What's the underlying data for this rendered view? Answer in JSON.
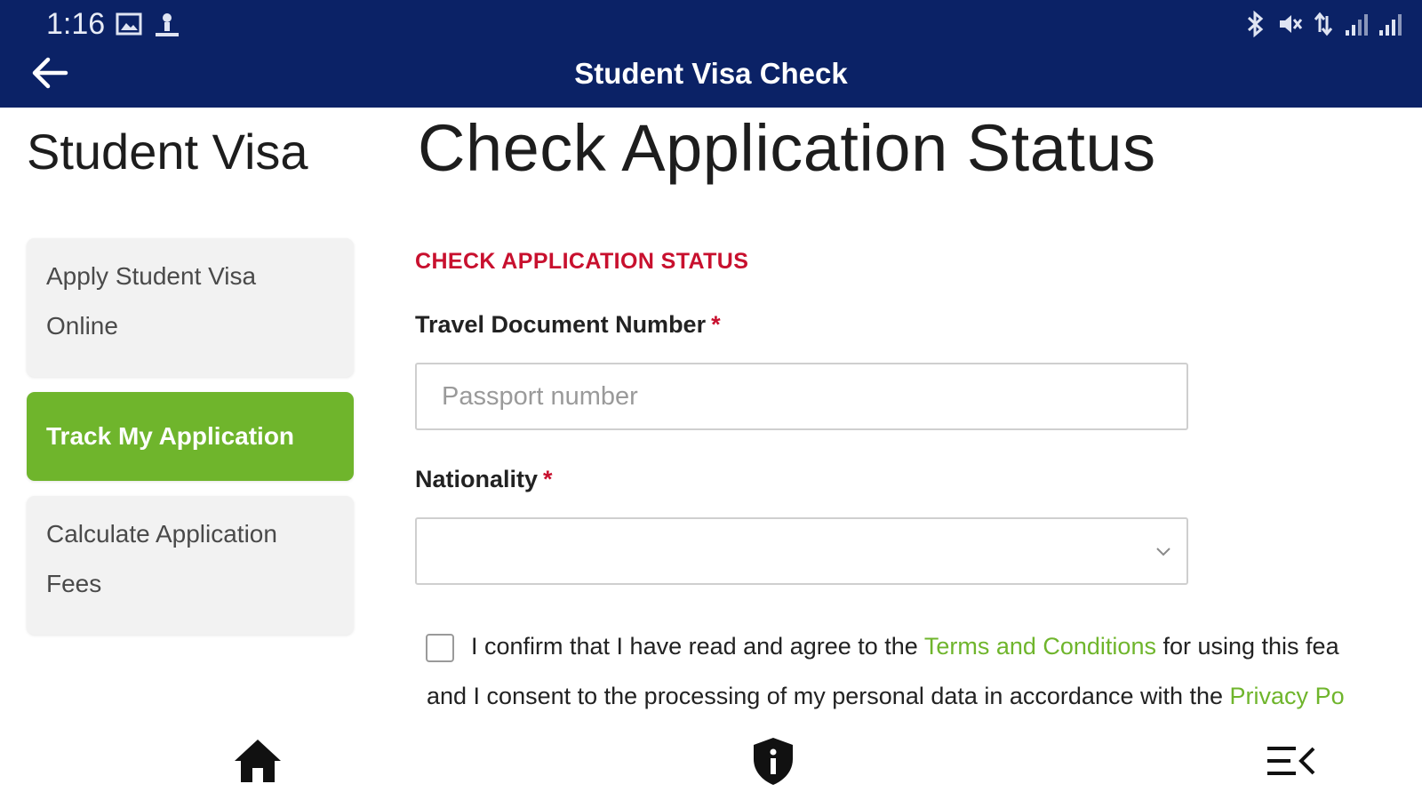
{
  "status_bar": {
    "time": "1:16",
    "icons_left": [
      "image-notification-icon",
      "person-notification-icon"
    ],
    "icons_right": [
      "bluetooth-icon",
      "mute-icon",
      "data-icon",
      "signal-icon",
      "signal-icon"
    ]
  },
  "app_bar": {
    "title": "Student Visa Check",
    "back_icon": "arrow-left-icon"
  },
  "sidebar": {
    "title": "Student Visa",
    "items": [
      {
        "label_line1": "Apply Student Visa",
        "label_line2": "Online",
        "active": false
      },
      {
        "label": "Track My Application",
        "active": true
      },
      {
        "label_line1": "Calculate Application",
        "label_line2": "Fees",
        "active": false
      }
    ]
  },
  "main": {
    "title": "Check Application Status",
    "section_heading": "CHECK APPLICATION STATUS",
    "travel_document": {
      "label": "Travel Document Number",
      "required_mark": "*",
      "placeholder": "Passport number",
      "value": ""
    },
    "nationality": {
      "label": "Nationality",
      "required_mark": "*",
      "selected": ""
    },
    "consent": {
      "checked": false,
      "line1_prefix": "I confirm that I have read and agree to the ",
      "line1_link": "Terms and Conditions",
      "line1_suffix": " for using this fea",
      "line2_prefix": "and I consent to the processing of my personal data in accordance with the ",
      "line2_link": "Privacy Po"
    }
  },
  "bottom_nav": {
    "items": [
      "home-icon",
      "info-shield-icon",
      "menu-icon"
    ]
  },
  "colors": {
    "app_bar": "#0b2266",
    "active_green": "#6fb52c",
    "heading_red": "#c8102e",
    "link_green": "#6fb52c"
  }
}
